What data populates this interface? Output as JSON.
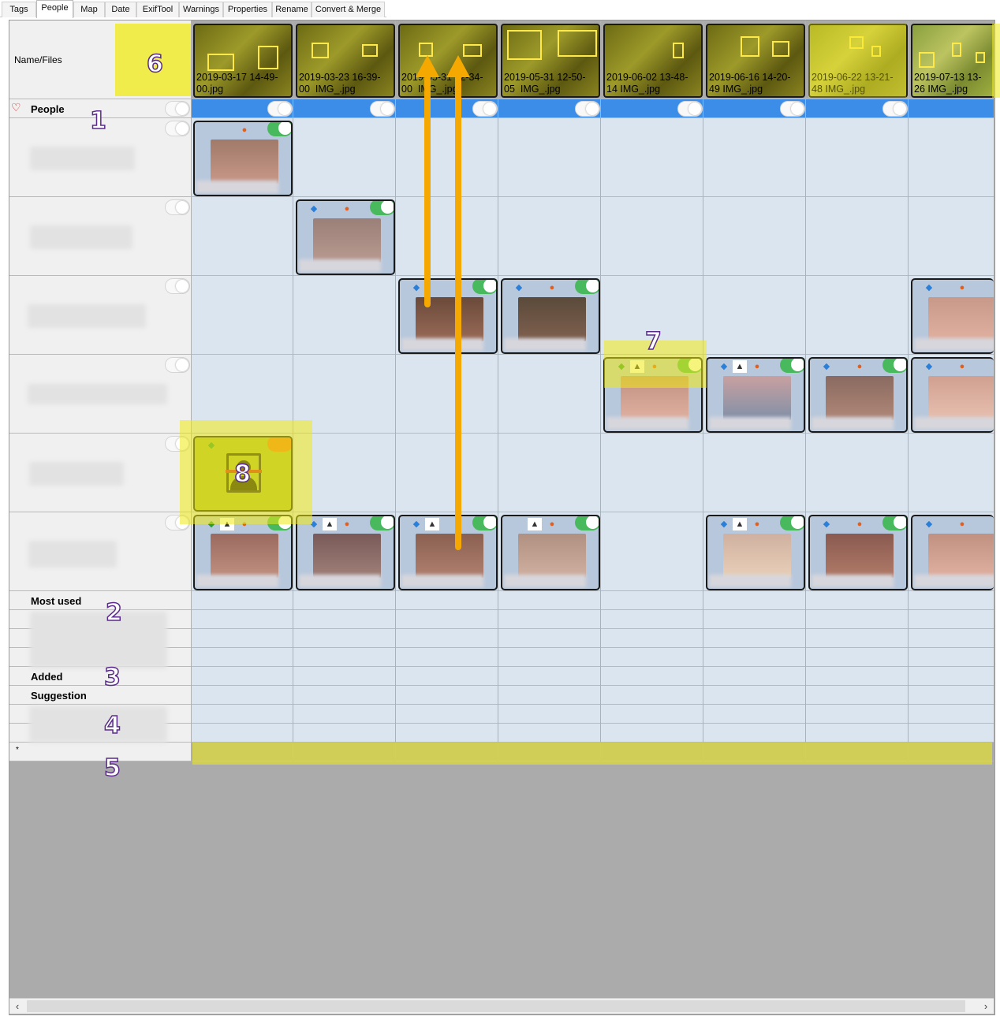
{
  "tabs": [
    "Tags",
    "People",
    "Map",
    "Date",
    "ExifTool",
    "Warnings",
    "Properties",
    "Rename",
    "Convert & Merge"
  ],
  "active_tab": "People",
  "header": {
    "corner_label": "Name/Files"
  },
  "files": [
    {
      "line1": "2019-03-17 14-49-",
      "line2": "00.jpg"
    },
    {
      "line1": "2019-03-23 16-39-",
      "line2": "00  IMG_.jpg"
    },
    {
      "line1": "2019-05-31 12-34-",
      "line2": "00  IMG_.jpg"
    },
    {
      "line1": "2019-05-31 12-50-",
      "line2": "05  IMG_.jpg"
    },
    {
      "line1": "2019-06-02 13-48-",
      "line2": "14 IMG_.jpg"
    },
    {
      "line1": "2019-06-16 14-20-",
      "line2": "49 IMG_.jpg"
    },
    {
      "line1": "2019-06-22 13-21-",
      "line2": "48 IMG_.jpg"
    },
    {
      "line1": "2019-07-13 13-",
      "line2": "26 IMG_.jpg"
    }
  ],
  "groups": {
    "people": "People",
    "most_used": "Most used",
    "added": "Added",
    "suggestion": "Suggestion",
    "new_row": "*"
  },
  "callouts": [
    "1",
    "2",
    "3",
    "4",
    "5",
    "6",
    "7",
    "8"
  ],
  "icons": {
    "people_group": "heart-icon",
    "exif_badge": "exiftool-icon",
    "diamond": "diamond-icon",
    "image": "picture-icon",
    "region": "face-region-icon"
  },
  "colors": {
    "highlight": "#f0eb14",
    "arrow": "#f5a800",
    "group_bar": "#3c8de8",
    "toggle_on": "#48b95c"
  }
}
